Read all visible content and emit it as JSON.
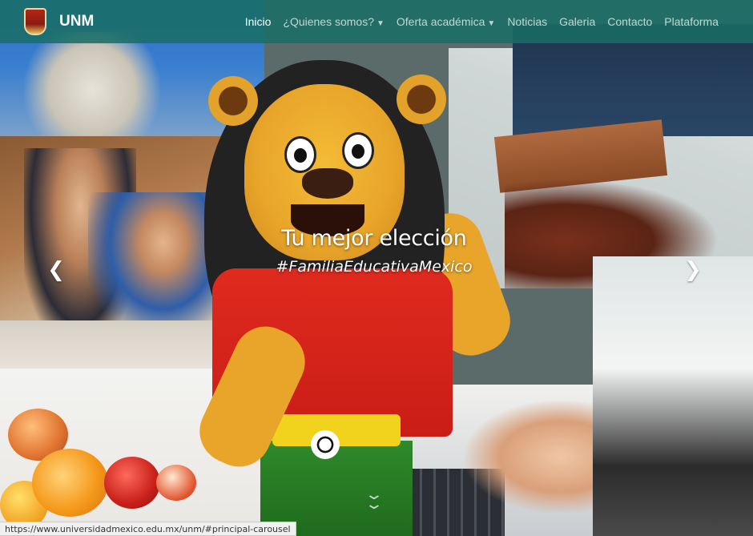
{
  "navbar": {
    "brand": "UNM",
    "links": [
      {
        "label": "Inicio",
        "active": true
      },
      {
        "label": "¿Quienes somos?",
        "dropdown": true
      },
      {
        "label": "Oferta académica",
        "dropdown": true
      },
      {
        "label": "Noticias"
      },
      {
        "label": "Galeria"
      },
      {
        "label": "Contacto"
      },
      {
        "label": "Plataforma"
      }
    ],
    "background": "#186e64"
  },
  "carousel": {
    "title": "Tu mejor elección",
    "tagline": "#FamiliaEducativaMexico",
    "prev_icon": "chevron-left-icon",
    "next_icon": "chevron-right-icon",
    "scroll_icon": "double-chevron-down-icon"
  },
  "status_bar": {
    "url": "https://www.universidadmexico.edu.mx/unm/#principal-carousel"
  }
}
